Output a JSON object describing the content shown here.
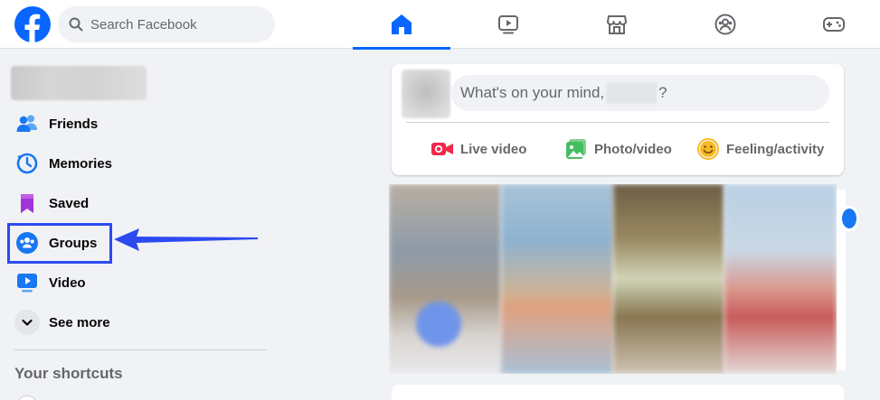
{
  "search": {
    "placeholder": "Search Facebook"
  },
  "nav": {
    "tabs": [
      {
        "name": "home",
        "active": true
      },
      {
        "name": "watch",
        "active": false
      },
      {
        "name": "marketplace",
        "active": false
      },
      {
        "name": "groups",
        "active": false
      },
      {
        "name": "gaming",
        "active": false
      }
    ]
  },
  "sidebar": {
    "items": [
      {
        "label": "Friends",
        "icon": "friends-icon"
      },
      {
        "label": "Memories",
        "icon": "memories-icon"
      },
      {
        "label": "Saved",
        "icon": "saved-icon"
      },
      {
        "label": "Groups",
        "icon": "groups-icon"
      },
      {
        "label": "Video",
        "icon": "video-icon"
      },
      {
        "label": "See more",
        "icon": "chevron-down-icon"
      }
    ],
    "shortcuts_title": "Your shortcuts"
  },
  "composer": {
    "prompt": "What's on your mind,",
    "prompt_suffix": "?",
    "actions": [
      {
        "label": "Live video",
        "color": "#f02849"
      },
      {
        "label": "Photo/video",
        "color": "#45bd62"
      },
      {
        "label": "Feeling/activity",
        "color": "#f7b928"
      }
    ]
  },
  "colors": {
    "accent": "#0866ff",
    "highlight": "#2c4af0"
  }
}
